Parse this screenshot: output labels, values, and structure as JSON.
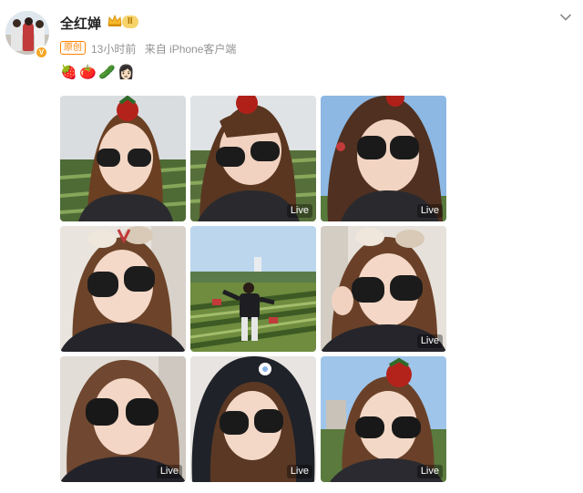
{
  "user": {
    "name": "全红婵",
    "level": "II",
    "original_tag": "原创",
    "time": "13小时前",
    "source": "来自 iPhone客户端"
  },
  "post": {
    "emojis": [
      "🍓",
      "🍅",
      "🥒",
      "👩🏻"
    ]
  },
  "photos": [
    {
      "scene": "strawberry-field",
      "live": ""
    },
    {
      "scene": "strawberry-field",
      "live": "Live"
    },
    {
      "scene": "blue-sky",
      "live": "Live"
    },
    {
      "scene": "car",
      "live": ""
    },
    {
      "scene": "field-wide",
      "live": ""
    },
    {
      "scene": "car",
      "live": "Live"
    },
    {
      "scene": "car",
      "live": "Live"
    },
    {
      "scene": "hood",
      "live": "Live"
    },
    {
      "scene": "blue-sky",
      "live": "Live"
    }
  ],
  "colors": {
    "accent_orange": "#ff8200",
    "meta_gray": "#939393"
  }
}
